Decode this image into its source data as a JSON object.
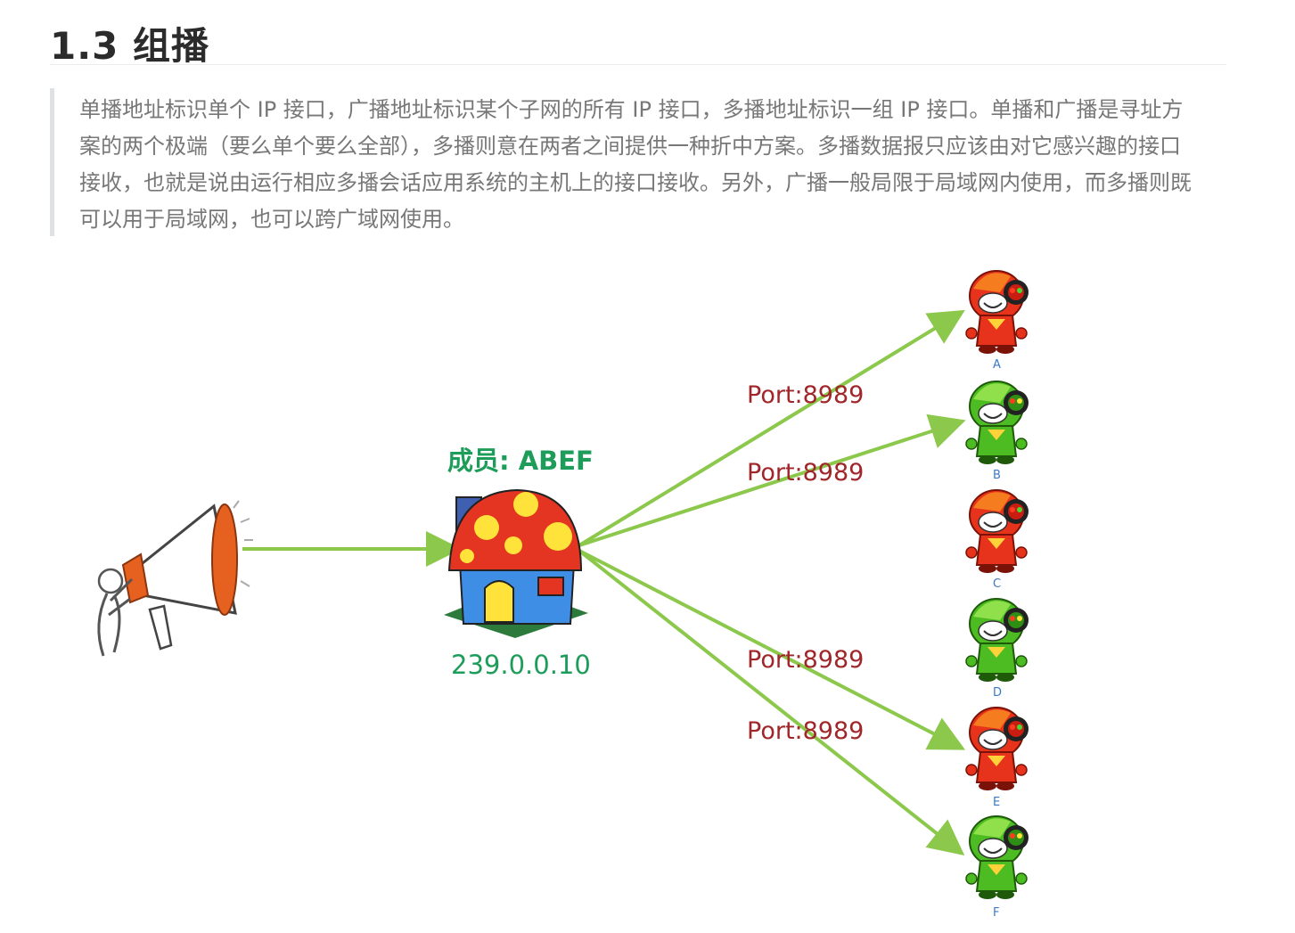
{
  "heading": "1.3 组播",
  "description": "单播地址标识单个 IP 接口，广播地址标识某个子网的所有 IP 接口，多播地址标识一组 IP 接口。单播和广播是寻址方案的两个极端（要么单个要么全部），多播则意在两者之间提供一种折中方案。多播数据报只应该由对它感兴趣的接口接收，也就是说由运行相应多播会话应用系统的主机上的接口接收。另外，广播一般局限于局域网内使用，而多播则既可以用于局域网，也可以跨广域网使用。",
  "diagram": {
    "sender_icon": "megaphone-person-icon",
    "group_icon": "mushroom-house-icon",
    "group_members_label": "成员: ABEF",
    "group_address": "239.0.0.10",
    "ports": [
      "Port:8989",
      "Port:8989",
      "Port:8989",
      "Port:8989"
    ],
    "receivers": [
      {
        "label": "A",
        "color": "red",
        "member": true
      },
      {
        "label": "B",
        "color": "green",
        "member": true
      },
      {
        "label": "C",
        "color": "red",
        "member": false
      },
      {
        "label": "D",
        "color": "green",
        "member": false
      },
      {
        "label": "E",
        "color": "red",
        "member": true
      },
      {
        "label": "F",
        "color": "green",
        "member": true
      }
    ],
    "colors": {
      "arrow": "#8cc84b",
      "port_text": "#a0262a",
      "group_text": "#1e9d5a",
      "receiver_label": "#3a78c8",
      "red_body": "#e8331c",
      "green_body": "#4dbb22"
    }
  }
}
